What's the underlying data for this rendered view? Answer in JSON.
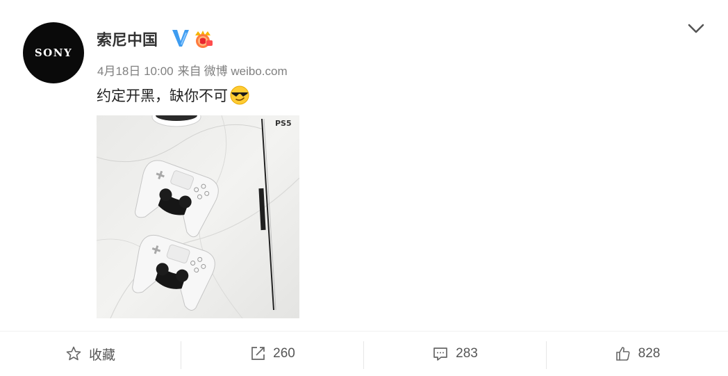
{
  "post": {
    "author": {
      "name": "索尼中国",
      "avatar_text": "SONY",
      "verified_icon": "verified-v-icon",
      "badge_icon": "vip-badge-icon"
    },
    "meta": {
      "date": "4月18日 10:00",
      "source_prefix": "来自",
      "source": "微博 weibo.com"
    },
    "text": "约定开黑，缺你不可",
    "emoji": "cool-sunglasses-emoji",
    "image_description_icon": "ps5-controllers-photo"
  },
  "actions": {
    "favorite": {
      "label": "收藏",
      "icon": "star-icon"
    },
    "repost": {
      "count": "260",
      "icon": "share-icon"
    },
    "comment": {
      "count": "283",
      "icon": "comment-icon"
    },
    "like": {
      "count": "828",
      "icon": "thumbs-up-icon"
    }
  },
  "colors": {
    "verified": "#3e9cf0",
    "text": "#333333",
    "meta": "#808080"
  }
}
